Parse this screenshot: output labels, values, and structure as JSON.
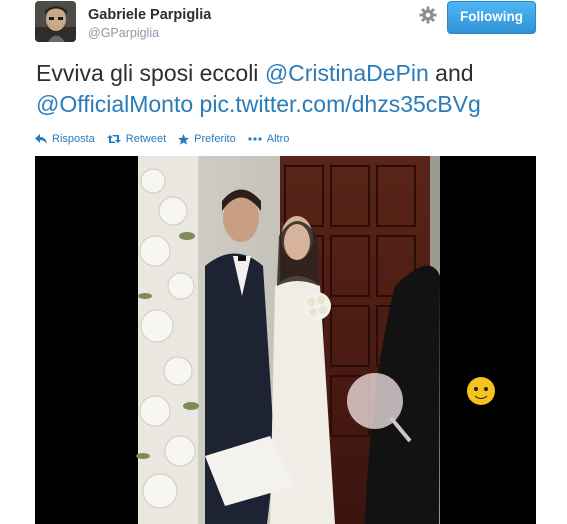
{
  "user": {
    "name": "Gabriele Parpiglia",
    "handle": "@GParpiglia"
  },
  "header": {
    "follow_label": "Following",
    "settings_icon": "gear-icon"
  },
  "tweet": {
    "text_1": "Evviva gli sposi eccoli ",
    "mention_1": "@CristinaDePin",
    "text_2": " and",
    "mention_2": "@OfficialMonto",
    "link": "pic.twitter.com/dhzs35cBVg"
  },
  "actions": [
    {
      "label": "Risposta",
      "icon": "reply-icon"
    },
    {
      "label": "Retweet",
      "icon": "retweet-icon"
    },
    {
      "label": "Preferito",
      "icon": "star-icon"
    },
    {
      "label": "Altro",
      "icon": "more-dots-icon"
    }
  ],
  "colors": {
    "link": "#2b7bb9",
    "follow_button": "#3aa2e6",
    "text": "#292f33",
    "muted": "#8899a6"
  }
}
